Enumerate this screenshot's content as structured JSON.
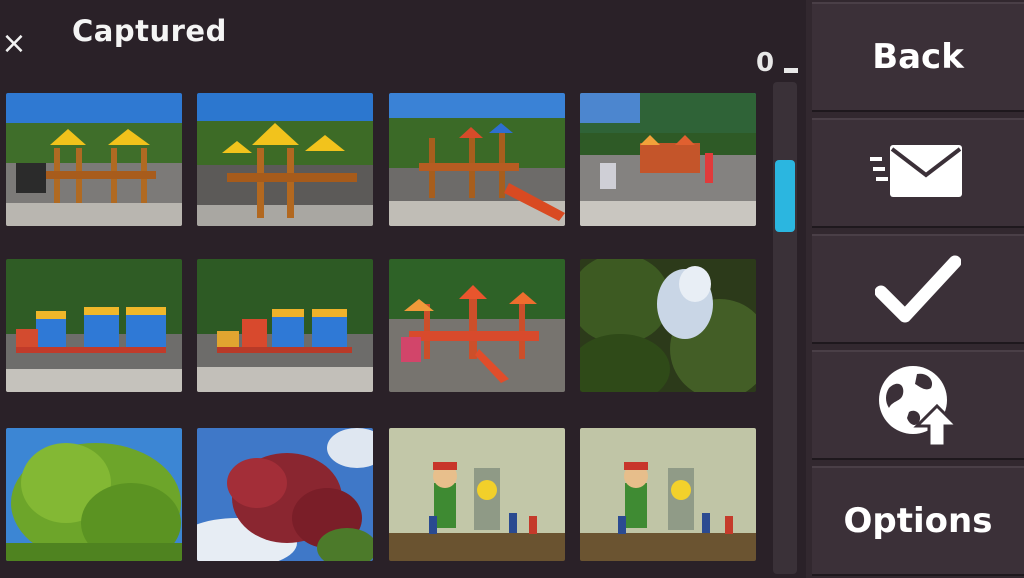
{
  "header": {
    "close_glyph": "×",
    "title": "Captured",
    "counter": "0"
  },
  "gallery": {
    "thumbnails": [
      {
        "name": "playground-1",
        "scene": "playground"
      },
      {
        "name": "playground-2",
        "scene": "playground"
      },
      {
        "name": "playground-3",
        "scene": "playground"
      },
      {
        "name": "playground-4",
        "scene": "playground"
      },
      {
        "name": "train-1",
        "scene": "train"
      },
      {
        "name": "train-2",
        "scene": "train"
      },
      {
        "name": "playground-5",
        "scene": "playground"
      },
      {
        "name": "tree-canopy",
        "scene": "canopy"
      },
      {
        "name": "green-tree",
        "scene": "tree"
      },
      {
        "name": "red-tree",
        "scene": "redtree"
      },
      {
        "name": "figurines-1",
        "scene": "figurines"
      },
      {
        "name": "figurines-2",
        "scene": "figurines"
      }
    ],
    "scroll_position": 0.15
  },
  "toolbar": {
    "back_label": "Back",
    "send_icon": "send-message-icon",
    "select_icon": "checkmark-icon",
    "share_icon": "web-upload-icon",
    "options_label": "Options"
  },
  "colors": {
    "background": "#2a2128",
    "toolbar": "#3b3038",
    "scrollbar_accent": "#2bb6e0",
    "text": "#ffffff"
  }
}
